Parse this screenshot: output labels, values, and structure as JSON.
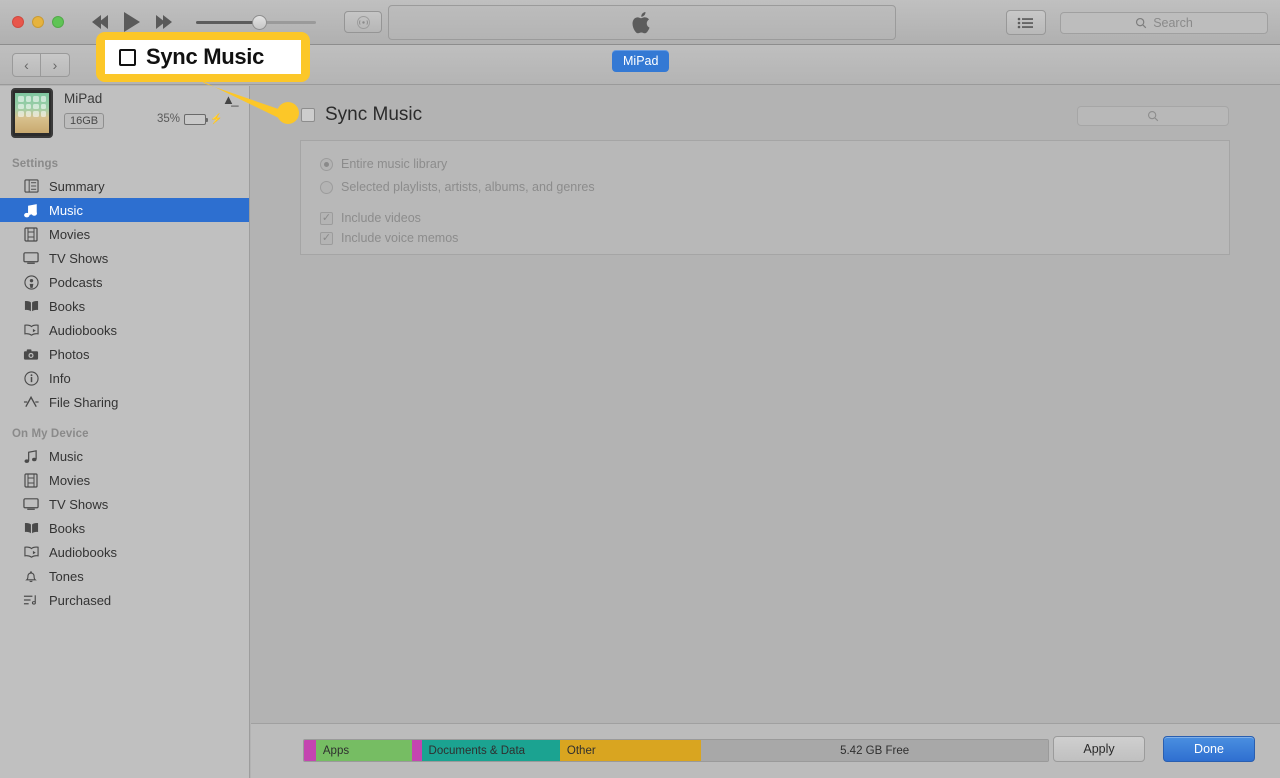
{
  "window": {
    "traffic_lights": [
      "close",
      "minimize",
      "maximize"
    ]
  },
  "toolbar": {
    "rewind_label": "Rewind",
    "play_label": "Play",
    "fastforward_label": "Fast Forward",
    "volume_percent": 52,
    "airplay_label": "AirPlay",
    "lcd_logo": "apple-logo",
    "list_view_label": "List View",
    "search_placeholder": "Search"
  },
  "navbar": {
    "back_label": "‹",
    "forward_label": "›",
    "device_tab_label": "MiPad"
  },
  "sidebar": {
    "device": {
      "name": "MiPad",
      "capacity": "16GB",
      "battery_percent": "35%",
      "battery_level": 35,
      "charging": true,
      "eject_label": "Eject"
    },
    "sections": [
      {
        "label": "Settings",
        "items": [
          {
            "label": "Summary",
            "icon": "summary-icon",
            "selected": false
          },
          {
            "label": "Music",
            "icon": "music-note-icon",
            "selected": true
          },
          {
            "label": "Movies",
            "icon": "film-icon",
            "selected": false
          },
          {
            "label": "TV Shows",
            "icon": "tv-icon",
            "selected": false
          },
          {
            "label": "Podcasts",
            "icon": "podcast-icon",
            "selected": false
          },
          {
            "label": "Books",
            "icon": "book-icon",
            "selected": false
          },
          {
            "label": "Audiobooks",
            "icon": "audiobook-icon",
            "selected": false
          },
          {
            "label": "Photos",
            "icon": "camera-icon",
            "selected": false
          },
          {
            "label": "Info",
            "icon": "info-icon",
            "selected": false
          },
          {
            "label": "File Sharing",
            "icon": "file-sharing-icon",
            "selected": false
          }
        ]
      },
      {
        "label": "On My Device",
        "items": [
          {
            "label": "Music",
            "icon": "music-note-icon",
            "selected": false
          },
          {
            "label": "Movies",
            "icon": "film-icon",
            "selected": false
          },
          {
            "label": "TV Shows",
            "icon": "tv-icon",
            "selected": false
          },
          {
            "label": "Books",
            "icon": "book-icon",
            "selected": false
          },
          {
            "label": "Audiobooks",
            "icon": "audiobook-icon",
            "selected": false
          },
          {
            "label": "Tones",
            "icon": "bell-icon",
            "selected": false
          },
          {
            "label": "Purchased",
            "icon": "playlist-icon",
            "selected": false
          }
        ]
      }
    ]
  },
  "main": {
    "sync_music_label": "Sync Music",
    "sync_music_checked": false,
    "search_placeholder": "",
    "radio_group": [
      {
        "label": "Entire music library",
        "selected": true
      },
      {
        "label": "Selected playlists, artists, albums, and genres",
        "selected": false
      }
    ],
    "checkboxes": [
      {
        "label": "Include videos",
        "checked": true
      },
      {
        "label": "Include voice memos",
        "checked": true
      }
    ]
  },
  "bottom": {
    "capacity_segments": [
      {
        "label": "",
        "width_pct": 1.6,
        "color": "#C445B0",
        "text_color": "#2f2f2f"
      },
      {
        "label": "Apps",
        "width_pct": 12.9,
        "color": "#76BD63",
        "text_color": "#2f2f2f"
      },
      {
        "label": "",
        "width_pct": 1.3,
        "color": "#C445B0",
        "text_color": "#2f2f2f"
      },
      {
        "label": "Documents & Data",
        "width_pct": 18.6,
        "color": "#1BA391",
        "text_color": "#2f2f2f"
      },
      {
        "label": "Other",
        "width_pct": 19.0,
        "color": "#D9A520",
        "text_color": "#2f2f2f"
      },
      {
        "label": "5.42 GB Free",
        "width_pct": 46.6,
        "color": "#A8A8A8",
        "text_color": "#2f2f2f"
      }
    ],
    "apply_label": "Apply",
    "done_label": "Done"
  },
  "callout": {
    "text": "Sync Music",
    "accent_color": "#FCC728",
    "checkbox_checked": false
  }
}
